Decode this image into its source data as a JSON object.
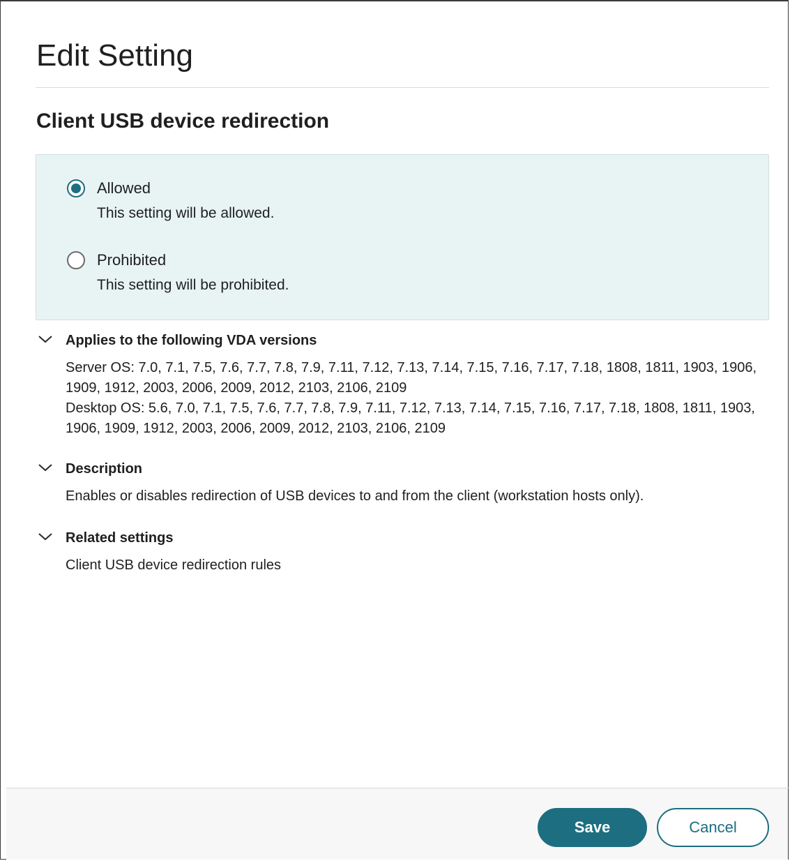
{
  "dialog": {
    "title": "Edit Setting",
    "setting_name": "Client USB device redirection"
  },
  "options": [
    {
      "label": "Allowed",
      "description": "This setting will be allowed.",
      "selected": true
    },
    {
      "label": "Prohibited",
      "description": "This setting will be prohibited.",
      "selected": false
    }
  ],
  "sections": {
    "vda": {
      "title": "Applies to the following VDA versions",
      "server_os": "Server OS: 7.0, 7.1, 7.5, 7.6, 7.7, 7.8, 7.9, 7.11, 7.12, 7.13, 7.14, 7.15, 7.16, 7.17, 7.18, 1808, 1811, 1903, 1906, 1909, 1912, 2003, 2006, 2009, 2012, 2103, 2106, 2109",
      "desktop_os": "Desktop OS: 5.6, 7.0, 7.1, 7.5, 7.6, 7.7, 7.8, 7.9, 7.11, 7.12, 7.13, 7.14, 7.15, 7.16, 7.17, 7.18, 1808, 1811, 1903, 1906, 1909, 1912, 2003, 2006, 2009, 2012, 2103, 2106, 2109"
    },
    "description": {
      "title": "Description",
      "text": "Enables or disables redirection of USB devices to and from the client (workstation hosts only)."
    },
    "related": {
      "title": "Related settings",
      "text": "Client USB device redirection rules"
    }
  },
  "footer": {
    "save_label": "Save",
    "cancel_label": "Cancel"
  },
  "colors": {
    "accent": "#1d6e80",
    "options_background": "#e8f4f4"
  },
  "icons": {
    "section_toggle": "chevron-down-icon"
  }
}
